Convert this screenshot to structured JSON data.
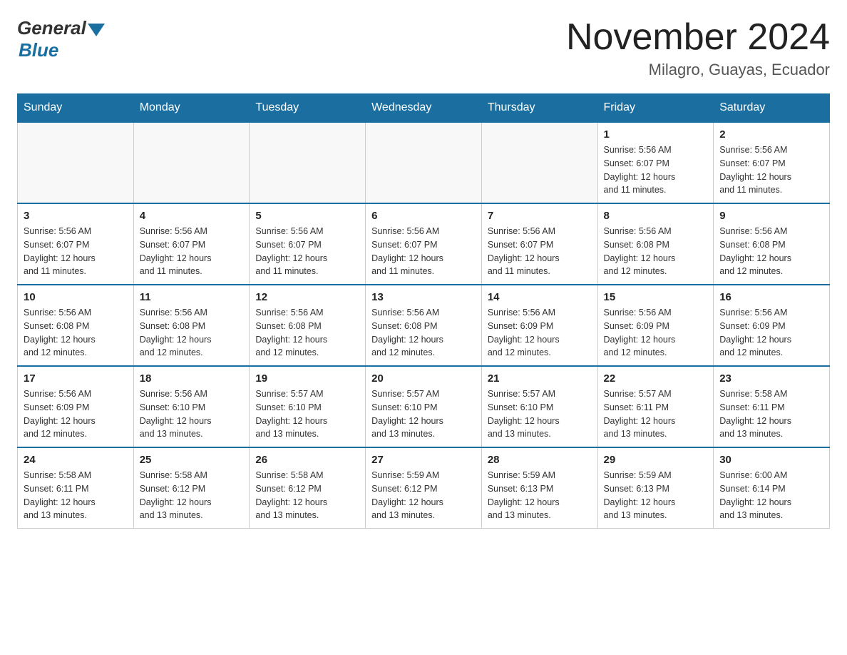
{
  "header": {
    "logo_general": "General",
    "logo_blue": "Blue",
    "month_title": "November 2024",
    "location": "Milagro, Guayas, Ecuador"
  },
  "days_of_week": [
    "Sunday",
    "Monday",
    "Tuesday",
    "Wednesday",
    "Thursday",
    "Friday",
    "Saturday"
  ],
  "weeks": [
    {
      "days": [
        {
          "number": "",
          "info": ""
        },
        {
          "number": "",
          "info": ""
        },
        {
          "number": "",
          "info": ""
        },
        {
          "number": "",
          "info": ""
        },
        {
          "number": "",
          "info": ""
        },
        {
          "number": "1",
          "info": "Sunrise: 5:56 AM\nSunset: 6:07 PM\nDaylight: 12 hours\nand 11 minutes."
        },
        {
          "number": "2",
          "info": "Sunrise: 5:56 AM\nSunset: 6:07 PM\nDaylight: 12 hours\nand 11 minutes."
        }
      ]
    },
    {
      "days": [
        {
          "number": "3",
          "info": "Sunrise: 5:56 AM\nSunset: 6:07 PM\nDaylight: 12 hours\nand 11 minutes."
        },
        {
          "number": "4",
          "info": "Sunrise: 5:56 AM\nSunset: 6:07 PM\nDaylight: 12 hours\nand 11 minutes."
        },
        {
          "number": "5",
          "info": "Sunrise: 5:56 AM\nSunset: 6:07 PM\nDaylight: 12 hours\nand 11 minutes."
        },
        {
          "number": "6",
          "info": "Sunrise: 5:56 AM\nSunset: 6:07 PM\nDaylight: 12 hours\nand 11 minutes."
        },
        {
          "number": "7",
          "info": "Sunrise: 5:56 AM\nSunset: 6:07 PM\nDaylight: 12 hours\nand 11 minutes."
        },
        {
          "number": "8",
          "info": "Sunrise: 5:56 AM\nSunset: 6:08 PM\nDaylight: 12 hours\nand 12 minutes."
        },
        {
          "number": "9",
          "info": "Sunrise: 5:56 AM\nSunset: 6:08 PM\nDaylight: 12 hours\nand 12 minutes."
        }
      ]
    },
    {
      "days": [
        {
          "number": "10",
          "info": "Sunrise: 5:56 AM\nSunset: 6:08 PM\nDaylight: 12 hours\nand 12 minutes."
        },
        {
          "number": "11",
          "info": "Sunrise: 5:56 AM\nSunset: 6:08 PM\nDaylight: 12 hours\nand 12 minutes."
        },
        {
          "number": "12",
          "info": "Sunrise: 5:56 AM\nSunset: 6:08 PM\nDaylight: 12 hours\nand 12 minutes."
        },
        {
          "number": "13",
          "info": "Sunrise: 5:56 AM\nSunset: 6:08 PM\nDaylight: 12 hours\nand 12 minutes."
        },
        {
          "number": "14",
          "info": "Sunrise: 5:56 AM\nSunset: 6:09 PM\nDaylight: 12 hours\nand 12 minutes."
        },
        {
          "number": "15",
          "info": "Sunrise: 5:56 AM\nSunset: 6:09 PM\nDaylight: 12 hours\nand 12 minutes."
        },
        {
          "number": "16",
          "info": "Sunrise: 5:56 AM\nSunset: 6:09 PM\nDaylight: 12 hours\nand 12 minutes."
        }
      ]
    },
    {
      "days": [
        {
          "number": "17",
          "info": "Sunrise: 5:56 AM\nSunset: 6:09 PM\nDaylight: 12 hours\nand 12 minutes."
        },
        {
          "number": "18",
          "info": "Sunrise: 5:56 AM\nSunset: 6:10 PM\nDaylight: 12 hours\nand 13 minutes."
        },
        {
          "number": "19",
          "info": "Sunrise: 5:57 AM\nSunset: 6:10 PM\nDaylight: 12 hours\nand 13 minutes."
        },
        {
          "number": "20",
          "info": "Sunrise: 5:57 AM\nSunset: 6:10 PM\nDaylight: 12 hours\nand 13 minutes."
        },
        {
          "number": "21",
          "info": "Sunrise: 5:57 AM\nSunset: 6:10 PM\nDaylight: 12 hours\nand 13 minutes."
        },
        {
          "number": "22",
          "info": "Sunrise: 5:57 AM\nSunset: 6:11 PM\nDaylight: 12 hours\nand 13 minutes."
        },
        {
          "number": "23",
          "info": "Sunrise: 5:58 AM\nSunset: 6:11 PM\nDaylight: 12 hours\nand 13 minutes."
        }
      ]
    },
    {
      "days": [
        {
          "number": "24",
          "info": "Sunrise: 5:58 AM\nSunset: 6:11 PM\nDaylight: 12 hours\nand 13 minutes."
        },
        {
          "number": "25",
          "info": "Sunrise: 5:58 AM\nSunset: 6:12 PM\nDaylight: 12 hours\nand 13 minutes."
        },
        {
          "number": "26",
          "info": "Sunrise: 5:58 AM\nSunset: 6:12 PM\nDaylight: 12 hours\nand 13 minutes."
        },
        {
          "number": "27",
          "info": "Sunrise: 5:59 AM\nSunset: 6:12 PM\nDaylight: 12 hours\nand 13 minutes."
        },
        {
          "number": "28",
          "info": "Sunrise: 5:59 AM\nSunset: 6:13 PM\nDaylight: 12 hours\nand 13 minutes."
        },
        {
          "number": "29",
          "info": "Sunrise: 5:59 AM\nSunset: 6:13 PM\nDaylight: 12 hours\nand 13 minutes."
        },
        {
          "number": "30",
          "info": "Sunrise: 6:00 AM\nSunset: 6:14 PM\nDaylight: 12 hours\nand 13 minutes."
        }
      ]
    }
  ]
}
